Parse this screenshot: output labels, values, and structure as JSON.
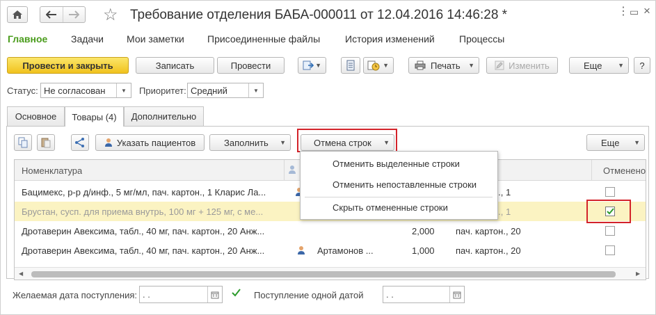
{
  "window": {
    "title": "Требование отделения БАБА-000011 от 12.04.2016 14:46:28 *"
  },
  "menu": [
    "Главное",
    "Задачи",
    "Мои заметки",
    "Присоединенные файлы",
    "История изменений",
    "Процессы"
  ],
  "toolbar": {
    "post_close": "Провести и закрыть",
    "write": "Записать",
    "post": "Провести",
    "print": "Печать",
    "edit": "Изменить",
    "more": "Еще",
    "help": "?"
  },
  "fields": {
    "status_label": "Статус:",
    "status_value": "Не согласован",
    "priority_label": "Приоритет:",
    "priority_value": "Средний"
  },
  "tabs": [
    "Основное",
    "Товары (4)",
    "Дополнительно"
  ],
  "table_toolbar": {
    "patients": "Указать пациентов",
    "fill": "Заполнить",
    "cancel_rows": "Отмена строк",
    "more": "Еще"
  },
  "dropdown": {
    "items": [
      "Отменить выделенные строки",
      "Отменить непоставленные строки",
      "Скрыть отмененные строки"
    ]
  },
  "table": {
    "headers": {
      "nomenclature": "Номенклатура",
      "cancelled": "Отменено"
    },
    "rows": [
      {
        "name": "Бацимекс, р-р д/инф., 5 мг/мл, пач. картон., 1  Кларис Ла...",
        "patient": "",
        "qty": "",
        "unit": "н., 1",
        "checked": false
      },
      {
        "name": "Брустан, сусп. для приема внутрь, 100 мг + 125 мг, с ме...",
        "patient": "",
        "qty": "",
        "unit": "н., 1",
        "checked": true
      },
      {
        "name": "Дротаверин Авексима, табл., 40 мг, пач. картон., 20  Анж...",
        "patient": "",
        "qty": "2,000",
        "unit": "пач. картон., 20",
        "checked": false
      },
      {
        "name": "Дротаверин Авексима, табл., 40 мг, пач. картон., 20  Анж...",
        "patient": "Артамонов ...",
        "qty": "1,000",
        "unit": "пач. картон., 20",
        "checked": false
      }
    ]
  },
  "bottom": {
    "date_label": "Желаемая дата поступления:",
    "date_value": " .  .",
    "single_date_label": "Поступление одной датой",
    "single_date_value": " .  ."
  },
  "colors": {
    "menu_green": "#4a9c1c",
    "primary_yellow": "#f5d02a",
    "selected_row": "#fbf3c2",
    "highlight_red": "#d3232a"
  }
}
